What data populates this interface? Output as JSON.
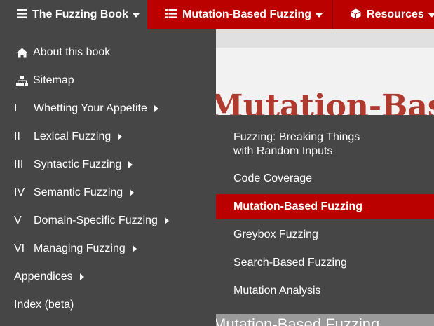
{
  "topnav": {
    "book_title": "The Fuzzing Book",
    "chapter_title": "Mutation-Based Fuzzing",
    "resources": "Resources"
  },
  "page": {
    "big_title": "Mutation-Based Fuzzing",
    "sub_title": "Mutation-Based Fuzzing"
  },
  "left_menu": {
    "about": "About this book",
    "sitemap": "Sitemap",
    "parts": [
      {
        "num": "I",
        "label": "Whetting Your Appetite"
      },
      {
        "num": "II",
        "label": "Lexical Fuzzing"
      },
      {
        "num": "III",
        "label": "Syntactic Fuzzing"
      },
      {
        "num": "IV",
        "label": "Semantic Fuzzing"
      },
      {
        "num": "V",
        "label": "Domain-Specific Fuzzing"
      },
      {
        "num": "VI",
        "label": "Managing Fuzzing"
      }
    ],
    "appendices": "Appendices",
    "index": "Index (beta)"
  },
  "sub_menu": {
    "items": [
      {
        "label_line1": "Fuzzing: Breaking Things",
        "label_line2": "with Random Inputs"
      },
      {
        "label_line1": "Code Coverage"
      },
      {
        "label_line1": "Mutation-Based Fuzzing",
        "active": true
      },
      {
        "label_line1": "Greybox Fuzzing"
      },
      {
        "label_line1": "Search-Based Fuzzing"
      },
      {
        "label_line1": "Mutation Analysis"
      }
    ]
  },
  "colors": {
    "nav_red": "#bb0000",
    "menu_gray": "#464646",
    "title_red": "#b03a2e"
  }
}
